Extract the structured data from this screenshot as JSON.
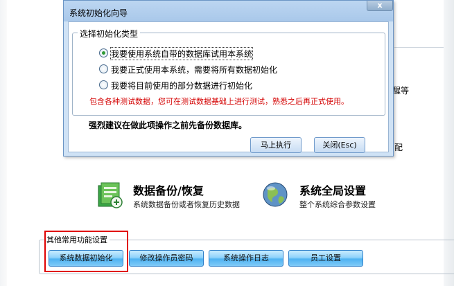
{
  "dialog": {
    "title": "系统初始化向导",
    "close_label": "x",
    "group_label": "选择初始化类型",
    "options": [
      {
        "label": "我要使用系统自带的数据库试用本系统",
        "checked": true
      },
      {
        "label": "我要正式使用本系统，需要将所有数据初始化",
        "checked": false
      },
      {
        "label": "我要将目前使用的部分数据进行初始化",
        "checked": false
      }
    ],
    "note": "包含各种测试数据，您可在测试数据基础上进行测试，熟悉之后再正式使用。",
    "warning": "强烈建议在做此项操作之前先备份数据库。",
    "execute_label": "马上执行",
    "close_button_label": "关闭(Esc)"
  },
  "background": {
    "stub_texts": [
      "醒等",
      "配"
    ],
    "cards": [
      {
        "title": "数据备份/恢复",
        "desc": "系统数据备份或者恢复历史数据",
        "icon": "backup-icon"
      },
      {
        "title": "系统全局设置",
        "desc": "整个系统综合参数设置",
        "icon": "globe-icon"
      }
    ],
    "other_group_label": "其他常用功能设置",
    "other_buttons": [
      "系统数据初始化",
      "修改操作员密码",
      "系统操作日志",
      "员工设置"
    ]
  },
  "colors": {
    "dialog_bg": "#cfe2f5",
    "note_red": "#d40000",
    "highlight_red": "#e00000",
    "button_blue": "#4fb3f2",
    "radio_dot": "#2f9a35"
  }
}
